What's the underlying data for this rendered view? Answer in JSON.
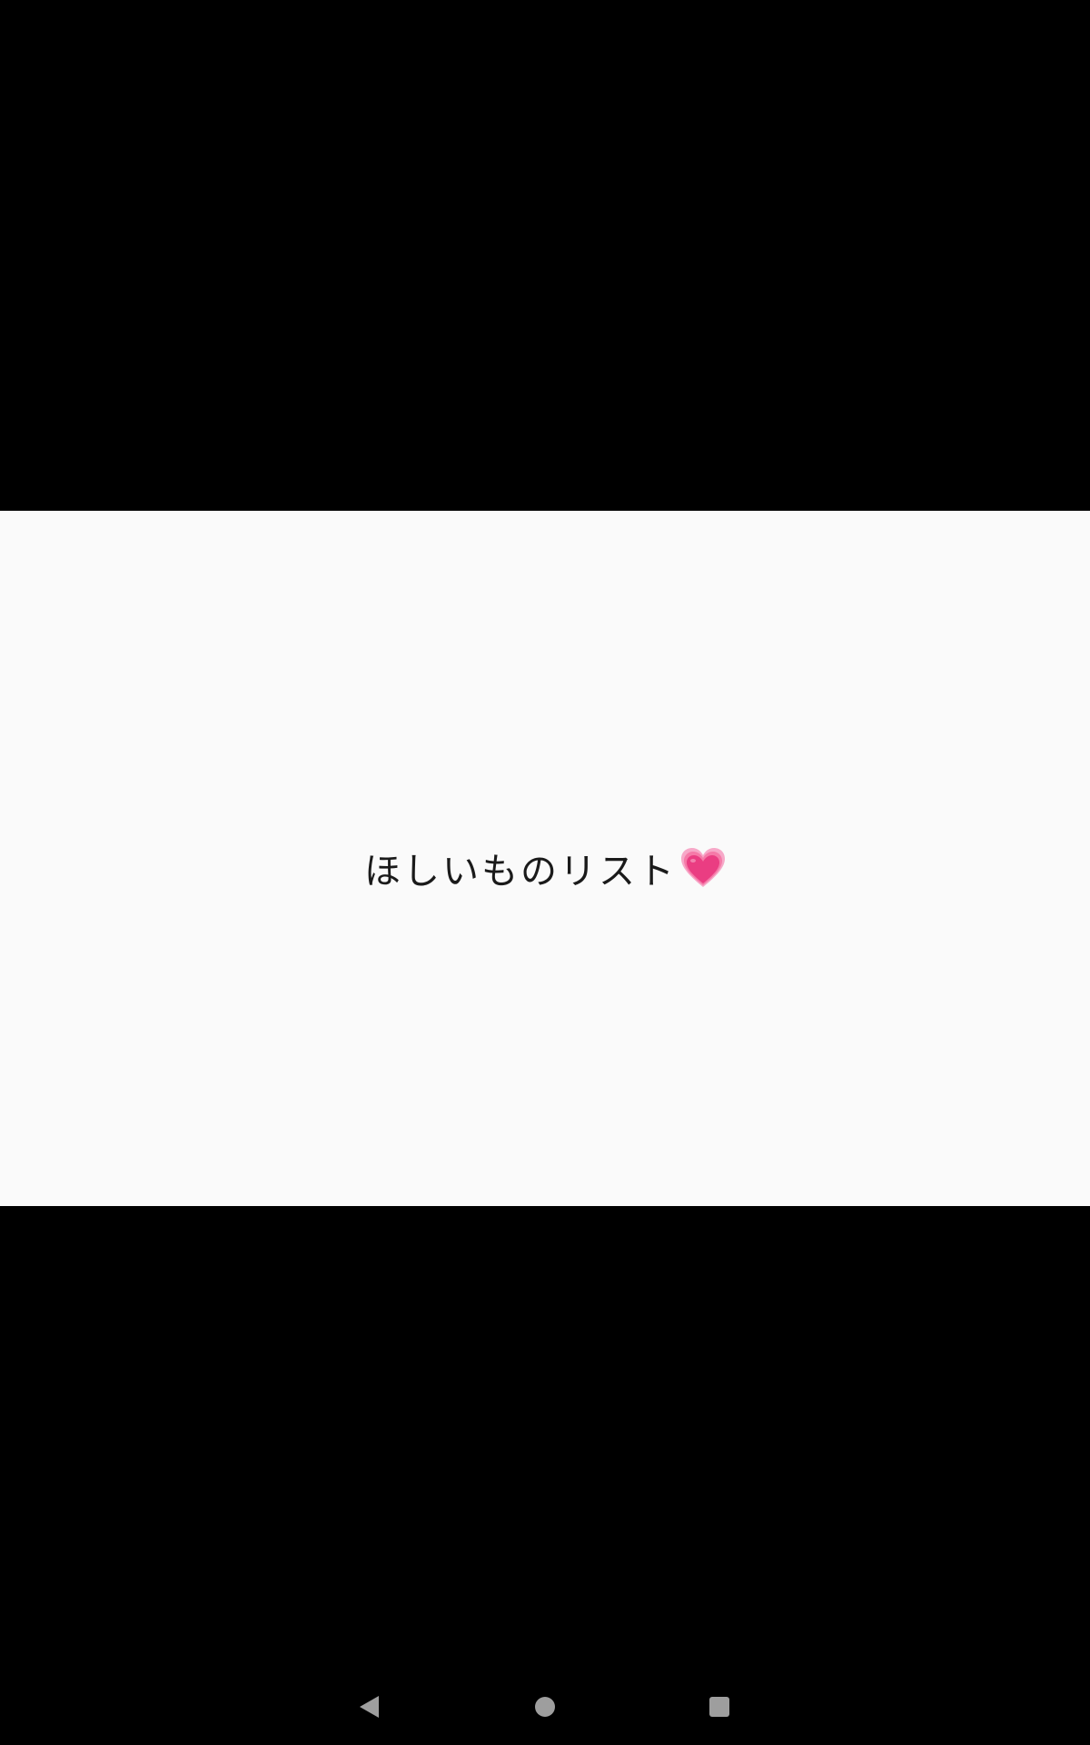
{
  "content": {
    "title": "ほしいものリスト",
    "title_icon": "growing-heart-icon",
    "heart_colors": {
      "outer": "#f7a8c8",
      "middle": "#f57aa8",
      "inner": "#ea3d82"
    }
  },
  "navigation_bar": {
    "buttons": [
      {
        "name": "back",
        "icon": "back-triangle-icon"
      },
      {
        "name": "home",
        "icon": "home-circle-icon"
      },
      {
        "name": "recents",
        "icon": "recents-square-icon"
      }
    ],
    "icon_color": "#9e9e9e"
  }
}
